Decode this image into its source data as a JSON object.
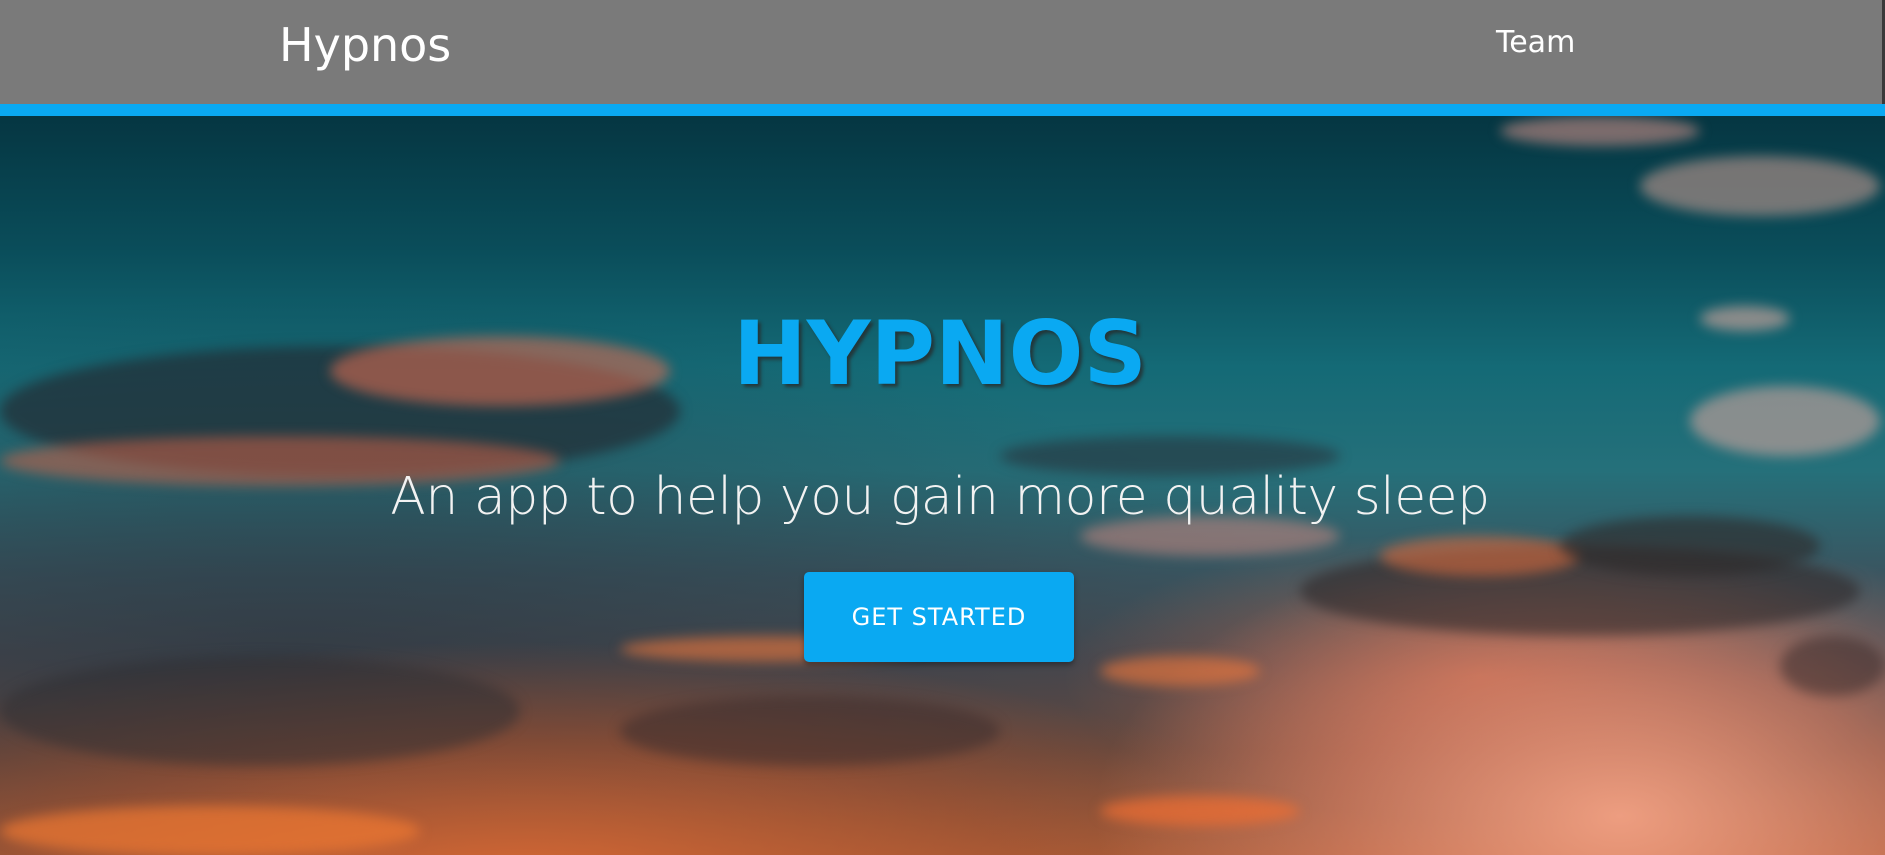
{
  "navbar": {
    "brand": "Hypnos",
    "links": [
      {
        "label": "Team"
      }
    ],
    "accent_color": "#0aa9f2",
    "background_color": "#7a7a7a"
  },
  "hero": {
    "title": "HYPNOS",
    "subtitle": "An app to help you gain more quality sleep",
    "cta_label": "GET STARTED",
    "title_color": "#0aa9f2",
    "cta_color": "#0aa9f2",
    "background_image": "sunset-sky-clouds"
  }
}
